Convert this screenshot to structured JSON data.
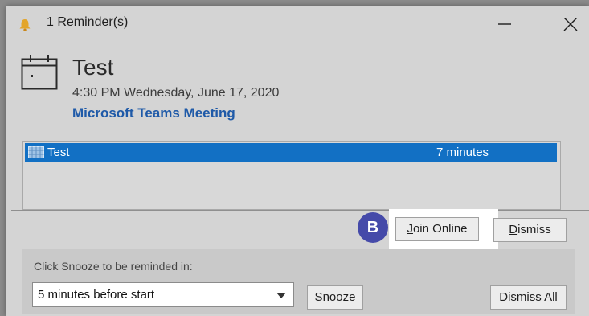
{
  "window": {
    "title": "1 Reminder(s)",
    "minimize_icon": "minimize-icon",
    "close_icon": "close-icon"
  },
  "reminder": {
    "subject": "Test",
    "when": "4:30 PM Wednesday, June 17, 2020",
    "location": "Microsoft Teams Meeting"
  },
  "list": {
    "rows": [
      {
        "subject": "Test",
        "due_in": "7 minutes",
        "icon": "appointment-icon"
      }
    ]
  },
  "actions": {
    "badge": "B",
    "join_mnemonic": "J",
    "join_rest": "oin Online",
    "dismiss_mnemonic": "D",
    "dismiss_rest": "ismiss"
  },
  "snooze": {
    "label": "Click Snooze to be reminded in:",
    "selected": "5 minutes before start",
    "snooze_mnemonic": "S",
    "snooze_rest": "nooze",
    "dismiss_all_prefix": "Dismiss ",
    "dismiss_all_mnemonic": "A",
    "dismiss_all_rest": "ll"
  },
  "colors": {
    "selection": "#1270c4",
    "link": "#1f5aa8",
    "badge": "#454aa9",
    "bell": "#e3a52a"
  }
}
